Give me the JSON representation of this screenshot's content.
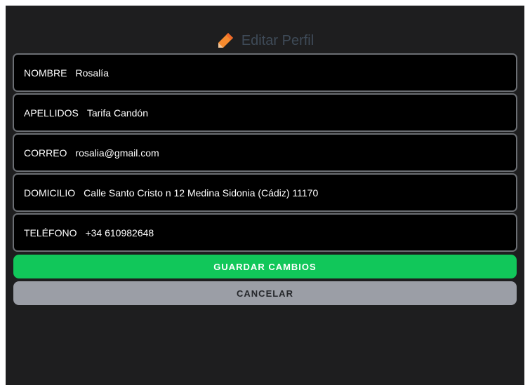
{
  "header": {
    "title": "Editar Perfil",
    "icon": "pencil-icon",
    "icon_color": "#f58a2e"
  },
  "fields": [
    {
      "label": "NOMBRE",
      "value": "Rosalía"
    },
    {
      "label": "APELLIDOS",
      "value": "Tarifa Candón"
    },
    {
      "label": "CORREO",
      "value": "rosalia@gmail.com"
    },
    {
      "label": "DOMICILIO",
      "value": "Calle Santo Cristo n 12 Medina Sidonia (Cádiz) 11170"
    },
    {
      "label": "TELÉFONO",
      "value": "+34 610982648"
    }
  ],
  "buttons": {
    "save_label": "GUARDAR CAMBIOS",
    "save_color": "#11c75a",
    "cancel_label": "CANCELAR",
    "cancel_color": "#9b9ea6"
  }
}
